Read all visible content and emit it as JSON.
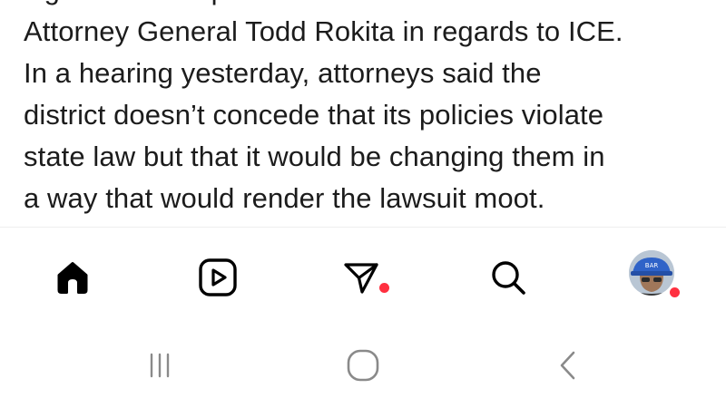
{
  "post": {
    "caption_lines": [
      "signed on to represent IPS in a lawsuit with",
      "Attorney General Todd Rokita in regards to ICE.",
      "In a hearing yesterday, attorneys said the",
      "district doesn’t concede that its policies violate",
      "state law but that it would be changing them in",
      "a way that would render the lawsuit moot."
    ]
  },
  "bottom_nav": {
    "items": [
      {
        "name": "home",
        "icon": "home-icon",
        "active": true
      },
      {
        "name": "reels",
        "icon": "reels-icon",
        "active": false
      },
      {
        "name": "messages",
        "icon": "direct-message-icon",
        "active": false,
        "notification_dot": true
      },
      {
        "name": "search",
        "icon": "search-icon",
        "active": false
      },
      {
        "name": "profile",
        "icon": "avatar",
        "active": false,
        "notification_dot": true
      }
    ],
    "notification_color": "#ff3040"
  },
  "system_nav": {
    "items": [
      {
        "name": "recent-apps",
        "icon": "recent-apps-icon"
      },
      {
        "name": "home",
        "icon": "home-circle-icon"
      },
      {
        "name": "back",
        "icon": "back-chevron-icon"
      }
    ],
    "color": "#8a8a8a"
  }
}
